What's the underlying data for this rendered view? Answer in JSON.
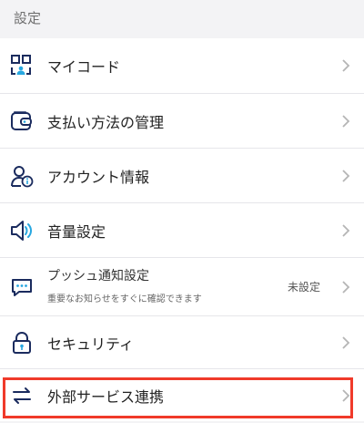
{
  "header": {
    "title": "設定"
  },
  "items": [
    {
      "label": "マイコード",
      "icon": "qr-code-icon"
    },
    {
      "label": "支払い方法の管理",
      "icon": "wallet-icon"
    },
    {
      "label": "アカウント情報",
      "icon": "user-info-icon"
    },
    {
      "label": "音量設定",
      "icon": "speaker-icon"
    },
    {
      "label": "プッシュ通知設定",
      "sublabel": "重要なお知らせをすぐに確認できます",
      "value": "未設定",
      "icon": "chat-bubble-icon"
    },
    {
      "label": "セキュリティ",
      "icon": "lock-icon"
    },
    {
      "label": "外部サービス連携",
      "icon": "swap-arrows-icon"
    }
  ],
  "colors": {
    "icon_navy": "#1a2b5e",
    "icon_blue": "#27a7e0",
    "highlight": "#f03a2a",
    "chevron": "#b5b5b5"
  }
}
